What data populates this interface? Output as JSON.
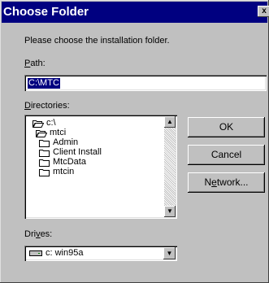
{
  "window": {
    "title": "Choose Folder",
    "close_glyph": "x"
  },
  "instructions": "Please choose the installation folder.",
  "path": {
    "label_prefix": "",
    "label_hotkey": "P",
    "label_rest": "ath:",
    "value": "C:\\MTC"
  },
  "directories": {
    "label_hotkey": "D",
    "label_rest": "irectories:",
    "items": [
      {
        "label": "c:\\",
        "icon": "open-folder-icon"
      },
      {
        "label": "mtci",
        "icon": "open-folder-icon"
      },
      {
        "label": "Admin",
        "icon": "folder-icon"
      },
      {
        "label": "Client Install",
        "icon": "folder-icon"
      },
      {
        "label": "MtcData",
        "icon": "folder-icon"
      },
      {
        "label": "mtcin",
        "icon": "folder-icon"
      }
    ]
  },
  "buttons": {
    "ok": "OK",
    "cancel": "Cancel",
    "network_prefix": "N",
    "network_hotkey": "e",
    "network_rest": "twork..."
  },
  "drives": {
    "label_prefix": "Dri",
    "label_hotkey": "v",
    "label_rest": "es:",
    "selected": "c: win95a",
    "icon": "drive-icon"
  },
  "colors": {
    "titlebar": "#000080",
    "face": "#c0c0c0",
    "selection": "#000080"
  }
}
